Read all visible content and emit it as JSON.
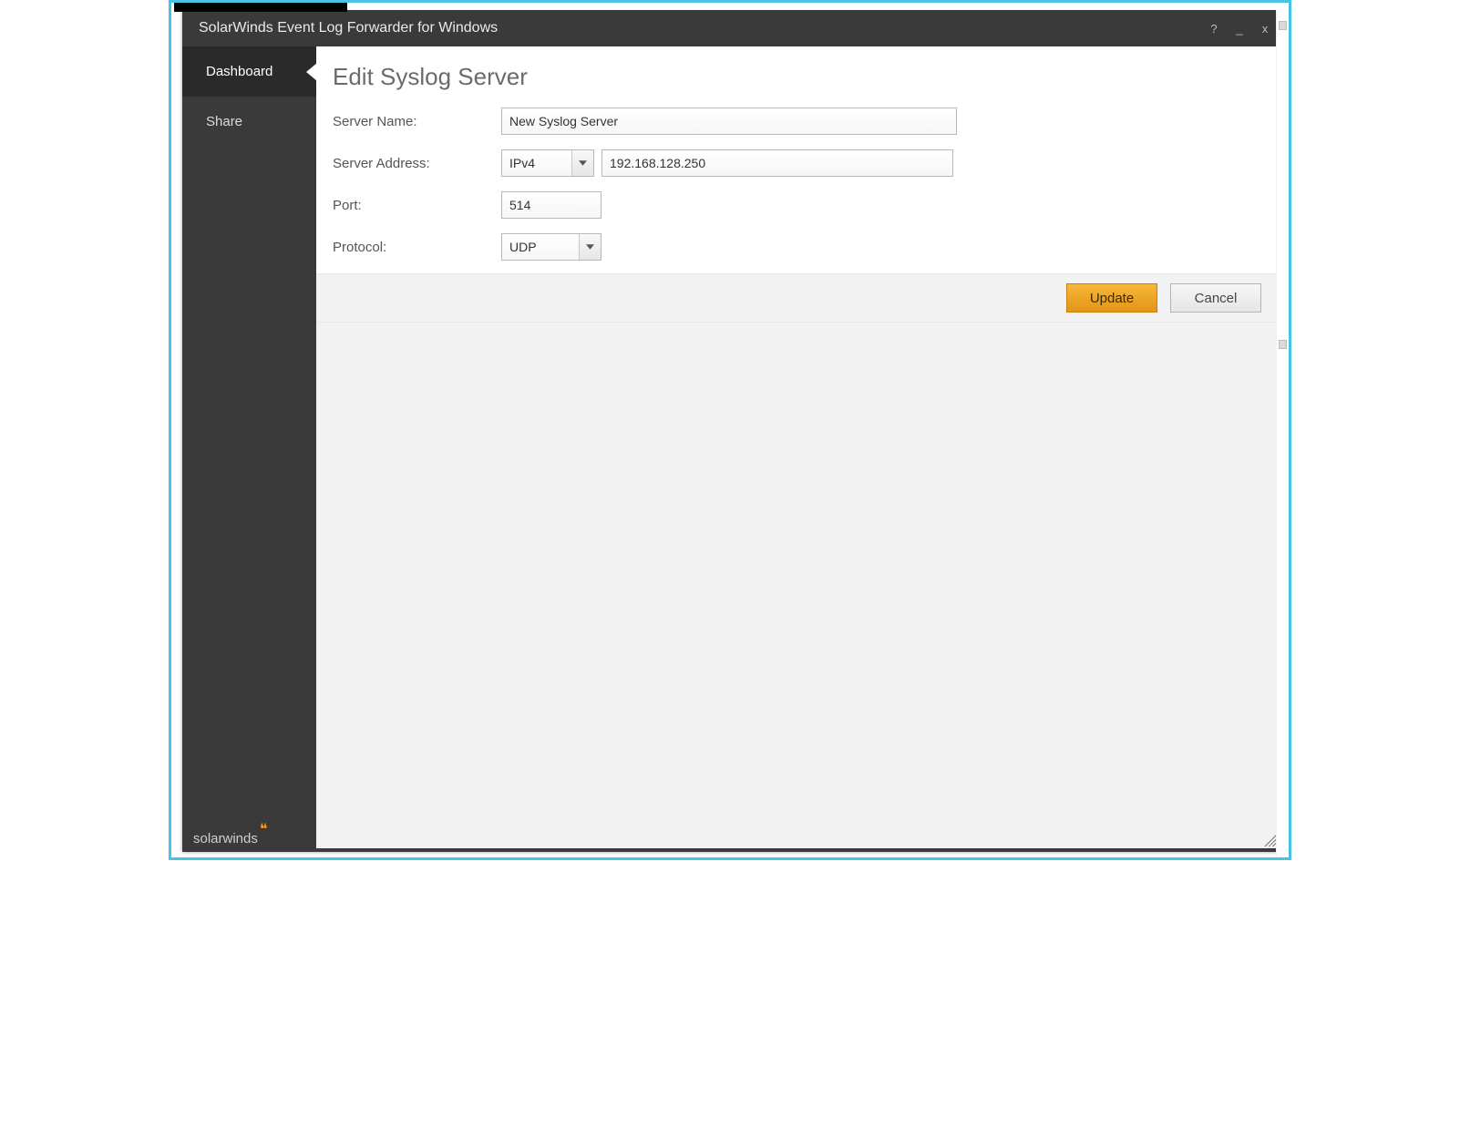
{
  "window": {
    "title": "SolarWinds Event Log Forwarder for Windows"
  },
  "sidebar": {
    "items": [
      {
        "label": "Dashboard",
        "active": true
      },
      {
        "label": "Share",
        "active": false
      }
    ],
    "brand": "solarwinds"
  },
  "page": {
    "heading": "Edit Syslog Server"
  },
  "form": {
    "server_name": {
      "label": "Server Name:",
      "value": "New Syslog Server"
    },
    "server_address": {
      "label": "Server Address:",
      "ip_version": "IPv4",
      "address": "192.168.128.250"
    },
    "port": {
      "label": "Port:",
      "value": "514"
    },
    "protocol": {
      "label": "Protocol:",
      "value": "UDP"
    }
  },
  "actions": {
    "primary": "Update",
    "secondary": "Cancel"
  },
  "titlebar": {
    "help": "?",
    "min": "_",
    "close": "x"
  }
}
